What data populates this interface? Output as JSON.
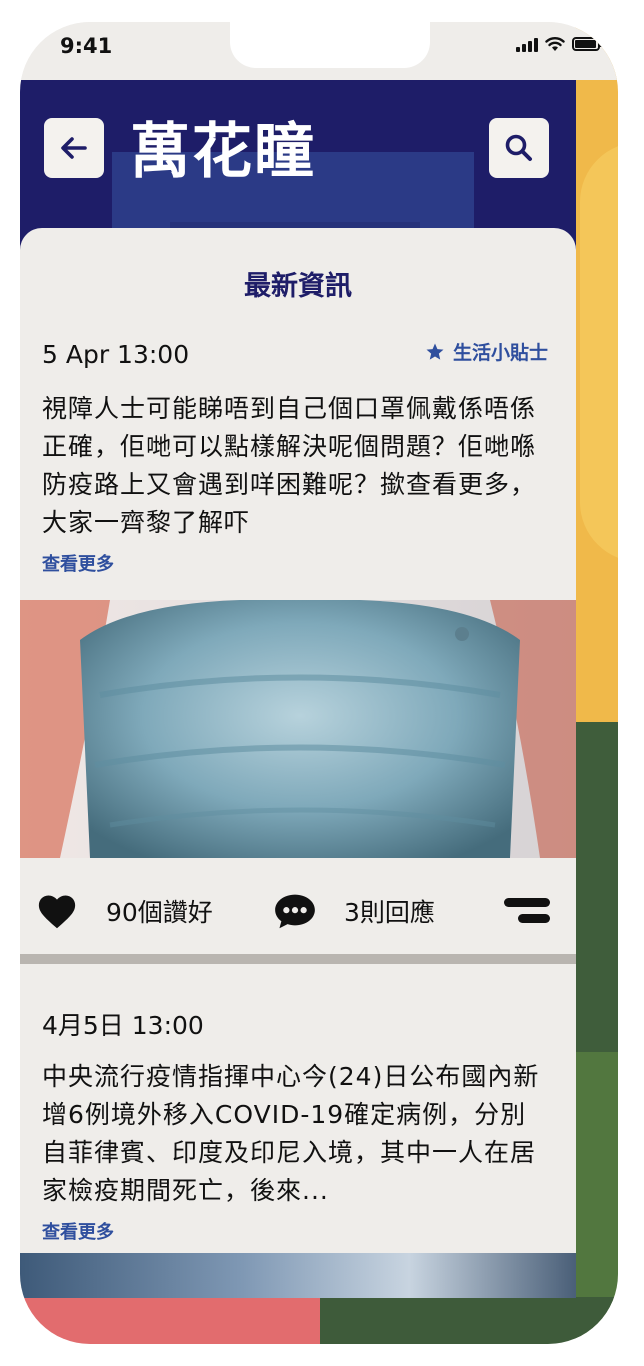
{
  "status_bar": {
    "time": "9:41"
  },
  "header": {
    "title": "萬花瞳"
  },
  "feed": {
    "section_title": "最新資訊",
    "posts": [
      {
        "date": "5 Apr 13:00",
        "tag": "生活小貼士",
        "body": "視障人士可能睇唔到自己個口罩佩戴係唔係正確，佢哋可以點樣解決呢個問題？佢哋喺防疫路上又會遇到咩困難呢？撳查看更多，大家一齊黎了解吓",
        "more": "查看更多",
        "likes": "90個讚好",
        "replies": "3則回應"
      },
      {
        "date": "4月5日 13:00",
        "body": "中央流行疫情指揮中心今(24)日公布國內新增6例境外移入COVID-19確定病例，分別自菲律賓、印度及印尼入境，其中一人在居家檢疫期間死亡，後來...",
        "more": "查看更多"
      }
    ]
  },
  "colors": {
    "header_bg": "#1e1d68",
    "accent": "#2f4f9e",
    "card_bg": "#efedea"
  }
}
